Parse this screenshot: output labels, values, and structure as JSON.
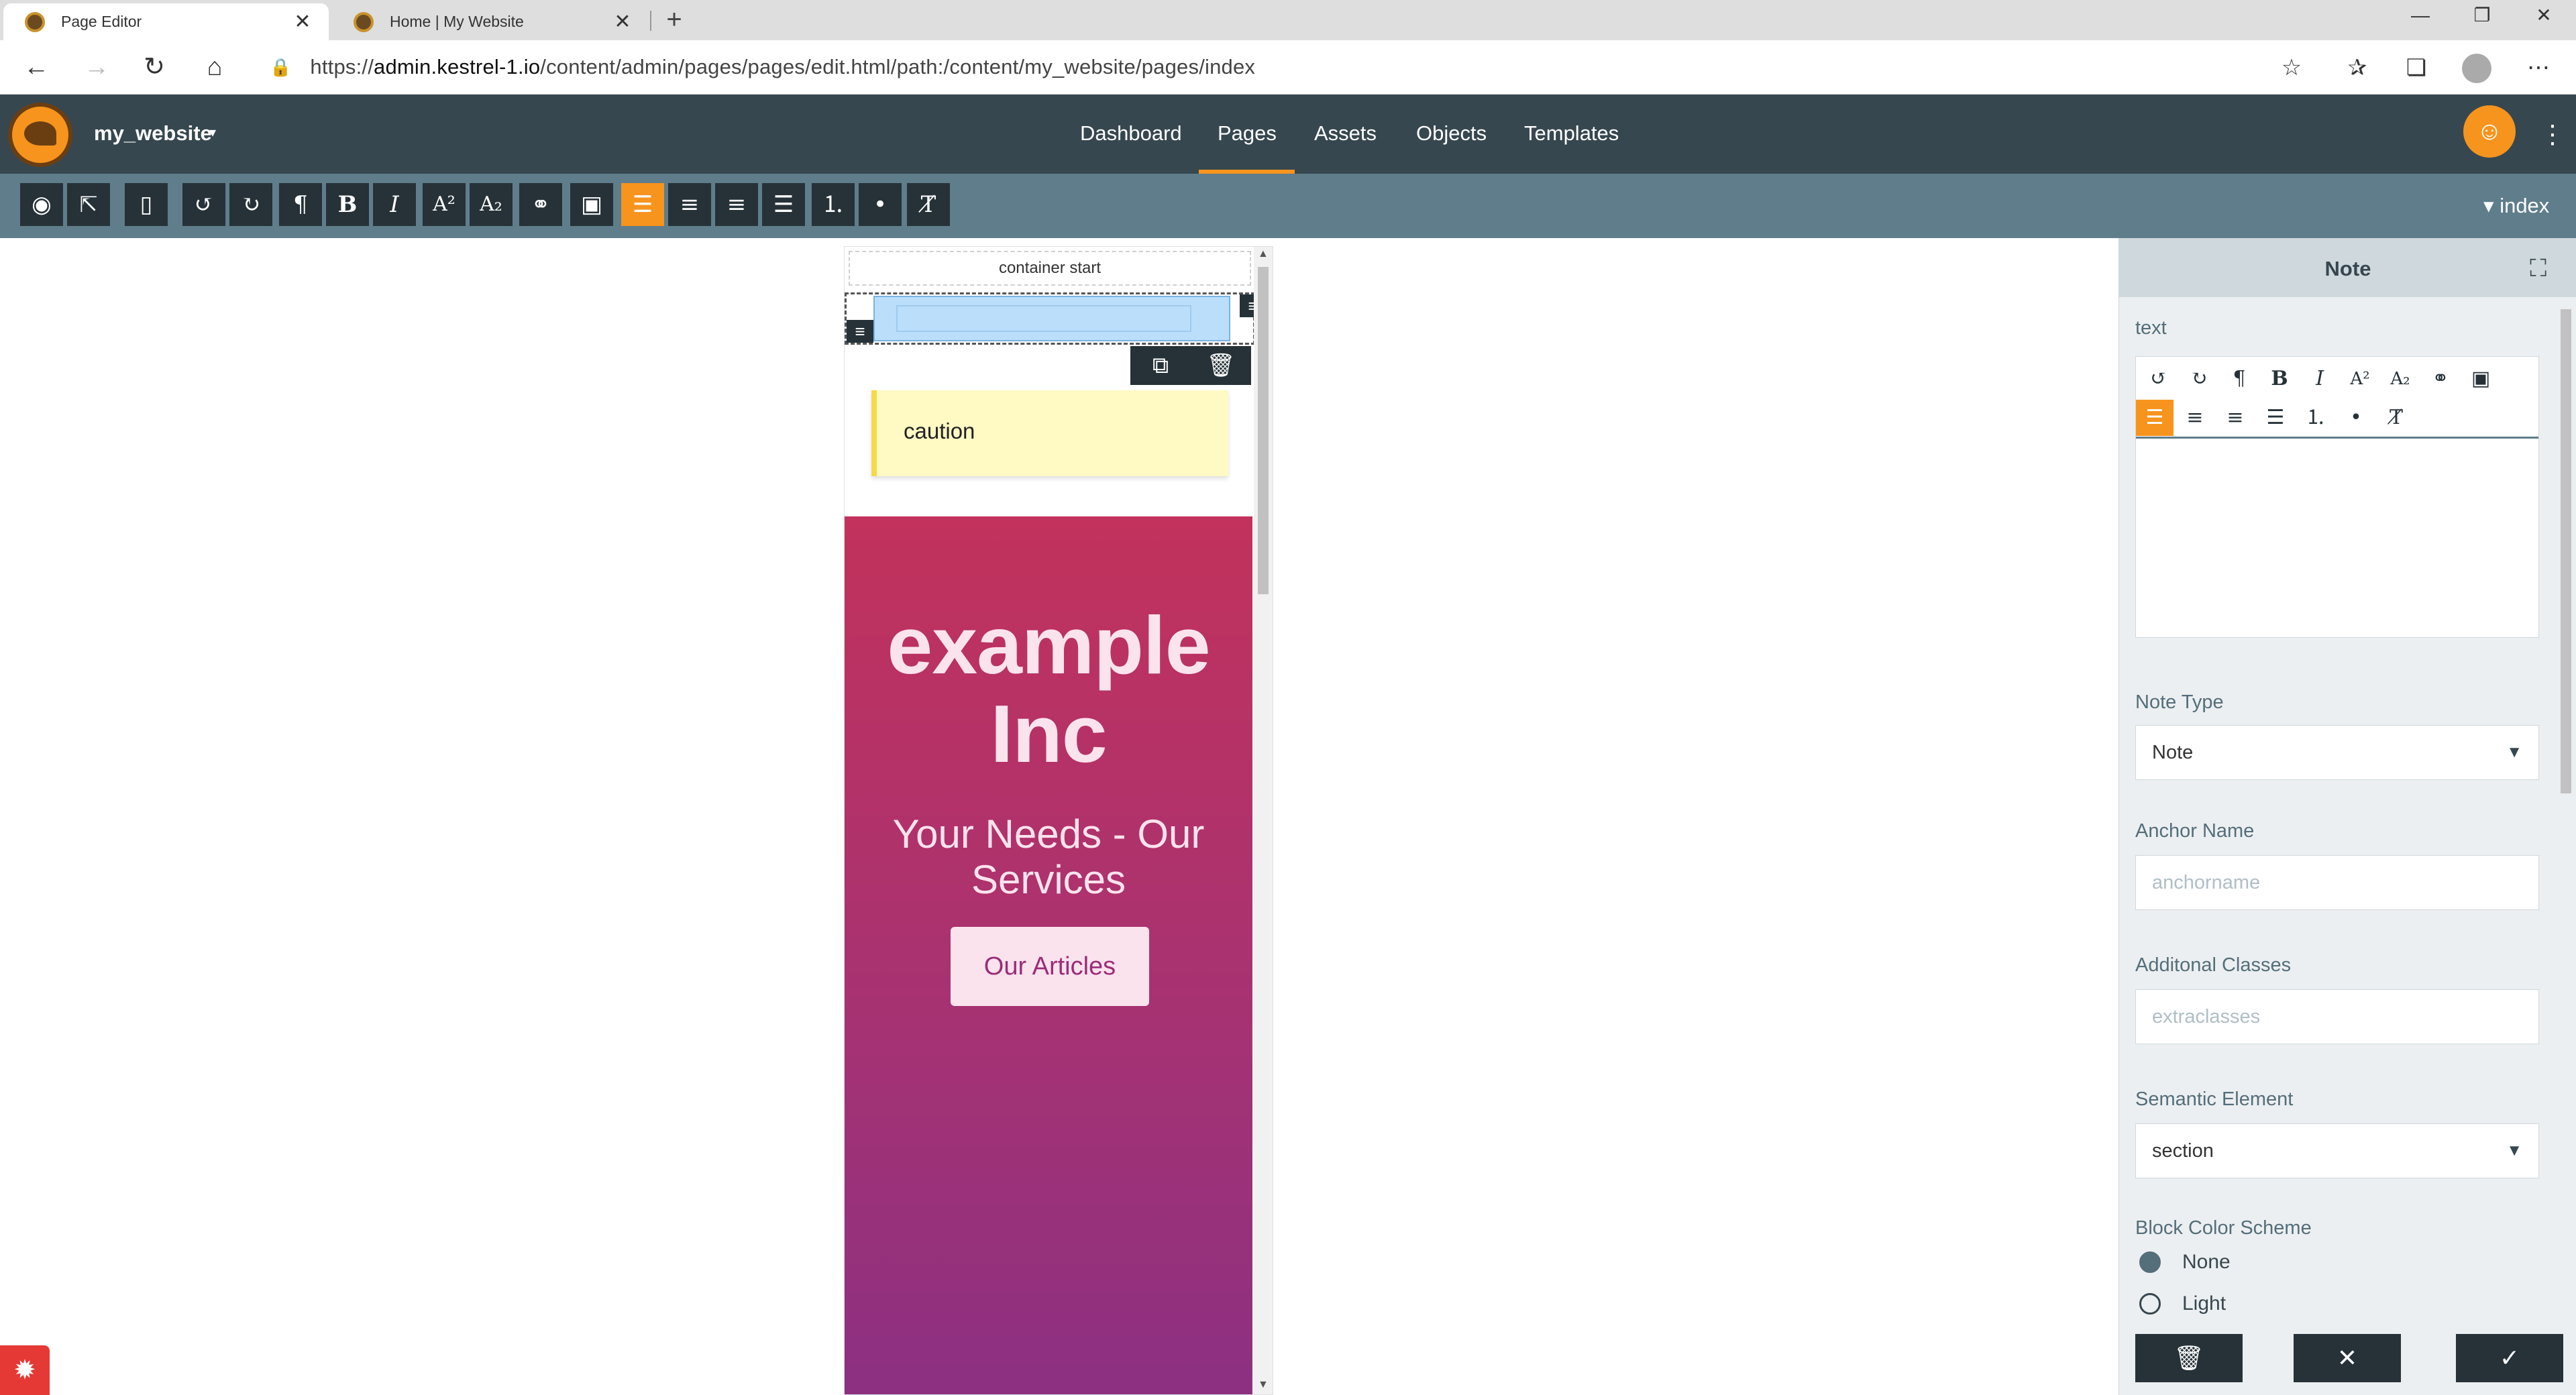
{
  "browser": {
    "tabs": [
      {
        "title": "Page Editor",
        "active": true
      },
      {
        "title": "Home | My Website",
        "active": false
      }
    ],
    "new_tab_label": "+",
    "window_controls": {
      "minimize": "—",
      "restore": "❐",
      "close": "✕"
    },
    "url": {
      "scheme": "https://",
      "host": "admin.kestrel-1.io",
      "path": "/content/admin/pages/pages/edit.html/path:/content/my_website/pages/index"
    }
  },
  "app": {
    "site_name": "my_website",
    "site_caret": "▾",
    "nav": [
      "Dashboard",
      "Pages",
      "Assets",
      "Objects",
      "Templates"
    ],
    "active_nav": "Pages",
    "more_icon": "⋮",
    "index_label": "index",
    "index_caret": "▾"
  },
  "colors": {
    "header": "#37474f",
    "toolbar": "#607d8b",
    "accent": "#f7941d",
    "hero_top": "#c2325c",
    "hero_bottom": "#8c3082",
    "note_bg": "#fff9c4"
  },
  "toolbar": {
    "icons": [
      "eye-icon",
      "external-link-icon",
      "mobile-device-icon",
      "undo-icon",
      "redo-icon",
      "paragraph-icon",
      "bold-icon",
      "italic-icon",
      "superscript-icon",
      "subscript-icon",
      "link-icon",
      "image-icon",
      "align-left-icon",
      "align-center-icon",
      "align-right-icon",
      "align-justify-icon",
      "ordered-list-icon",
      "unordered-list-icon",
      "clear-format-icon"
    ],
    "active": "align-left-icon"
  },
  "canvas": {
    "container_start": "container start",
    "caution_text": "caution",
    "hero": {
      "title": "example Inc",
      "subtitle": "Your Needs - Our Services",
      "cta": "Our Articles"
    }
  },
  "panel": {
    "title": "Note",
    "text_label": "text",
    "note_type": {
      "label": "Note Type",
      "value": "Note"
    },
    "anchor_name": {
      "label": "Anchor Name",
      "placeholder": "anchorname"
    },
    "additional_classes": {
      "label": "Additonal Classes",
      "placeholder": "extraclasses"
    },
    "semantic_element": {
      "label": "Semantic Element",
      "value": "section"
    },
    "color_scheme": {
      "label": "Block Color Scheme",
      "options": [
        "None",
        "Light"
      ],
      "selected": "None"
    },
    "actions": {
      "delete": "🗑",
      "cancel": "✕",
      "confirm": "✓"
    }
  }
}
